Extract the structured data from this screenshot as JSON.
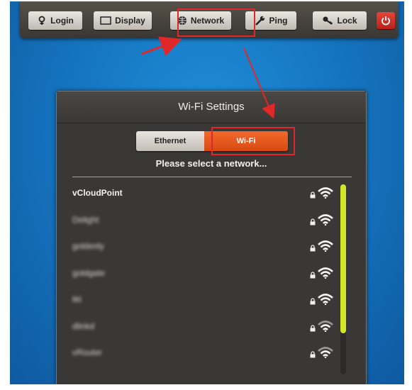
{
  "toolbar": {
    "login_label": "Login",
    "display_label": "Display",
    "network_label": "Network",
    "ping_label": "Ping",
    "lock_label": "Lock",
    "power_icon": "power-icon"
  },
  "dialog": {
    "title": "Wi-Fi Settings",
    "tabs": [
      {
        "label": "Ethernet",
        "selected": false
      },
      {
        "label": "Wi-Fi",
        "selected": true
      }
    ],
    "prompt": "Please select a network...",
    "networks": [
      {
        "name": "vCloudPoint",
        "secured": true,
        "signal": "strong"
      },
      {
        "name": "Delight",
        "secured": true,
        "signal": "strong",
        "obscured": true
      },
      {
        "name": "goldenly",
        "secured": true,
        "signal": "strong",
        "obscured": true
      },
      {
        "name": "goldgate",
        "secured": true,
        "signal": "strong",
        "obscured": true
      },
      {
        "name": "tkt",
        "secured": true,
        "signal": "strong",
        "obscured": true
      },
      {
        "name": "dlinkd",
        "secured": true,
        "signal": "medium",
        "obscured": true
      },
      {
        "name": "vRouter",
        "secured": true,
        "signal": "medium",
        "obscured": true
      }
    ]
  },
  "colors": {
    "desktop": "#1677c2",
    "accent_orange": "#e35a1c",
    "highlight_red": "#e02828",
    "scrollbar_thumb": "#d3e628",
    "power_red": "#c92a22"
  }
}
